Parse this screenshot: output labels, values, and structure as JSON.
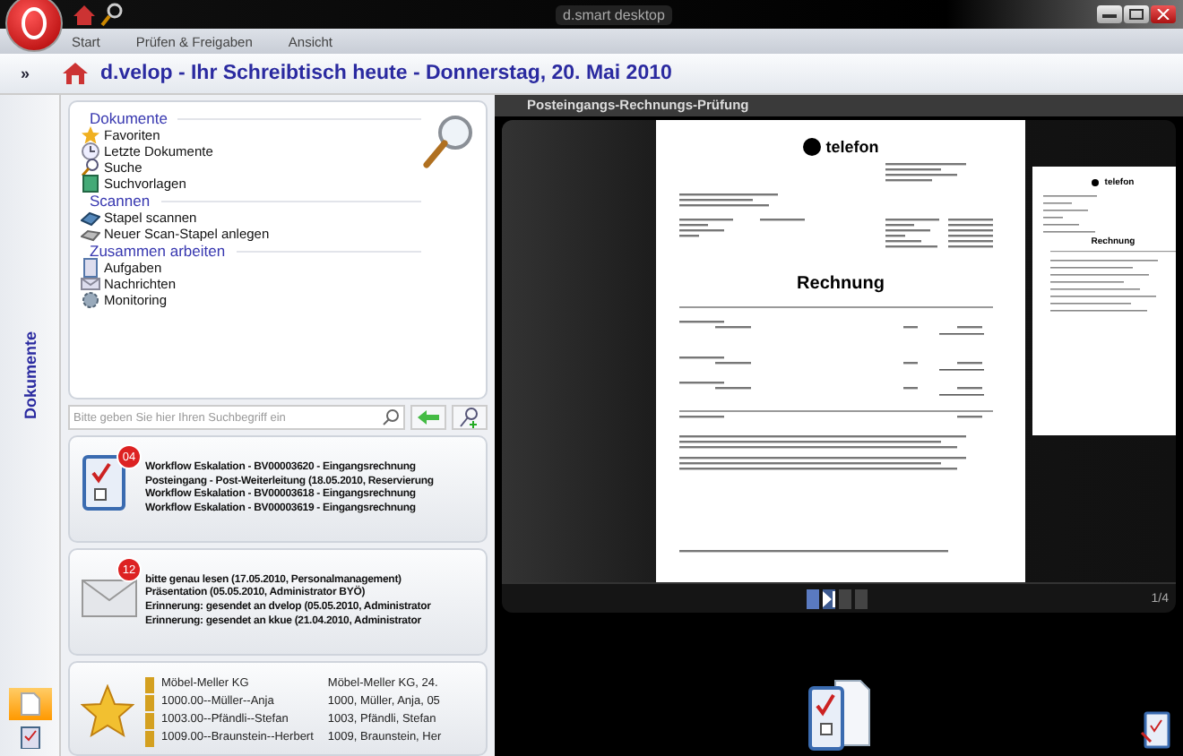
{
  "window": {
    "title": "d.smart desktop"
  },
  "menu": [
    "Start",
    "Prüfen & Freigaben",
    "Ansicht"
  ],
  "header": {
    "expand": "»",
    "title": "d.velop - Ihr Schreibtisch heute - Donnerstag, 20. Mai 2010"
  },
  "side_tab": "Dokumente",
  "nav": {
    "sections": [
      {
        "title": "Dokumente",
        "items": [
          {
            "label": "Favoriten",
            "kind": "star"
          },
          {
            "label": "Letzte Dokumente",
            "kind": "clock"
          },
          {
            "label": "Suche",
            "kind": "search"
          },
          {
            "label": "Suchvorlagen",
            "kind": "book"
          }
        ]
      },
      {
        "title": "Scannen",
        "items": [
          {
            "label": "Stapel scannen",
            "kind": "scanner"
          },
          {
            "label": "Neuer Scan-Stapel anlegen",
            "kind": "stack"
          }
        ]
      },
      {
        "title": "Zusammen arbeiten",
        "items": [
          {
            "label": "Aufgaben",
            "kind": "clipboard"
          },
          {
            "label": "Nachrichten",
            "kind": "mail"
          },
          {
            "label": "Monitoring",
            "kind": "gear"
          }
        ]
      }
    ]
  },
  "search": {
    "placeholder": "Bitte geben Sie hier Ihren Suchbegriff ein"
  },
  "tasks": {
    "badge": "04",
    "items": [
      "Workflow Eskalation - BV00003620 - Eingangsrechnung",
      "Posteingang - Post-Weiterleitung (18.05.2010, Reservierung",
      "Workflow Eskalation - BV00003618 - Eingangsrechnung",
      "Workflow Eskalation - BV00003619 - Eingangsrechnung"
    ]
  },
  "messages": {
    "badge": "12",
    "items": [
      "bitte genau lesen (17.05.2010, Personalmanagement)",
      "Präsentation (05.05.2010, Administrator BYÖ)",
      "Erinnerung: gesendet an dvelop (05.05.2010, Administrator",
      "Erinnerung: gesendet an kkue (21.04.2010, Administrator"
    ]
  },
  "favorites": [
    {
      "name": "Möbel-Meller KG",
      "detail": "Möbel-Meller KG, 24."
    },
    {
      "name": "1000.00--Müller--Anja",
      "detail": "1000, Müller, Anja, 05"
    },
    {
      "name": "1003.00--Pfändli--Stefan",
      "detail": "1003, Pfändli, Stefan"
    },
    {
      "name": "1009.00--Braunstein--Herbert",
      "detail": "1009, Braunstein, Her"
    }
  ],
  "viewer": {
    "title": "Posteingangs-Rechnungs-Prüfung",
    "brand": "telefon",
    "heading": "Rechnung",
    "small_brand": "telefon",
    "small_heading": "Rechnung"
  },
  "pager": {
    "buttons": [
      {
        "kind": "page",
        "selected": true
      },
      {
        "kind": "last",
        "selected": false
      },
      {
        "kind": "page",
        "selected": false
      },
      {
        "kind": "page",
        "selected": false
      }
    ],
    "counter": "1/4"
  }
}
